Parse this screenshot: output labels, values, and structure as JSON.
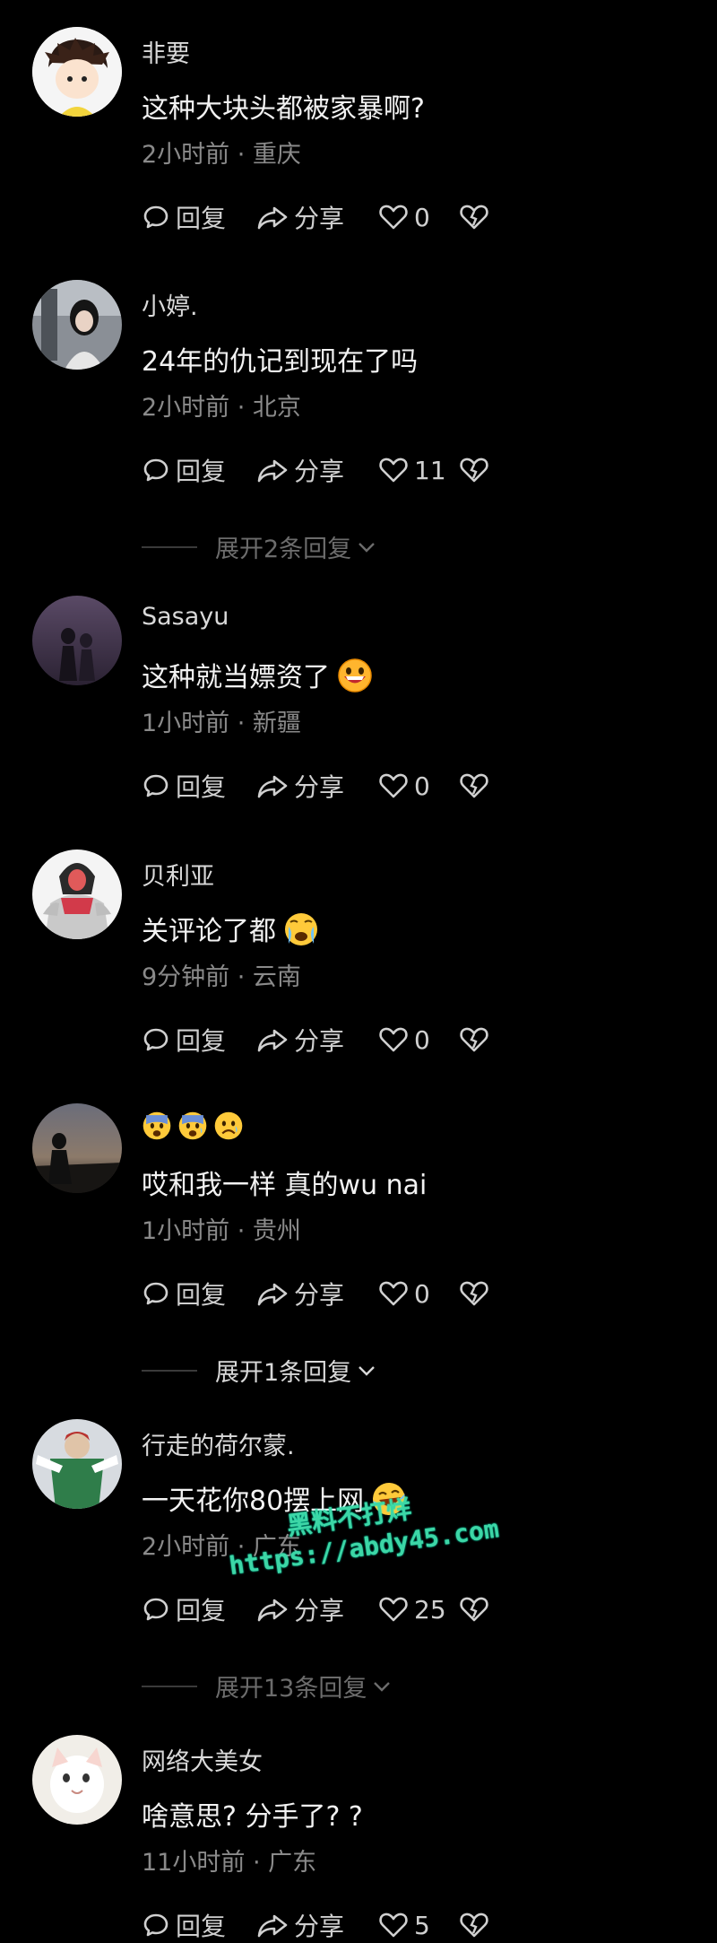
{
  "actions": {
    "reply_label": "回复",
    "share_label": "分享"
  },
  "comments": [
    {
      "username": "非要",
      "content": "这种大块头都被家暴啊?",
      "time": "2小时前",
      "location": "重庆",
      "meta": "2小时前 · 重庆",
      "likes": "0",
      "emoji": ""
    },
    {
      "username": "小婷.",
      "content": "24年的仇记到现在了吗",
      "time": "2小时前",
      "location": "北京",
      "meta": "2小时前 · 北京",
      "likes": "11",
      "emoji": ""
    },
    {
      "username": "Sasayu",
      "content": "这种就当嫖资了",
      "time": "1小时前",
      "location": "新疆",
      "meta": "1小时前 · 新疆",
      "likes": "0",
      "emoji": "grinning-face"
    },
    {
      "username": "贝利亚",
      "content": "关评论了都",
      "time": "9分钟前",
      "location": "云南",
      "meta": "9分钟前 · 云南",
      "likes": "0",
      "emoji": "crying-face"
    },
    {
      "username": "",
      "content": "哎和我一样 真的wu nai",
      "time": "1小时前",
      "location": "贵州",
      "meta": "1小时前 · 贵州",
      "likes": "0",
      "emoji": "",
      "username_emojis": [
        "anxious-face",
        "anxious-face",
        "sad-face"
      ]
    },
    {
      "username": "行走的荷尔蒙.",
      "content": "一天花你80摆上网",
      "time": "2小时前",
      "location": "广东",
      "meta": "2小时前 · 广东",
      "likes": "25",
      "emoji": "laughing-face"
    },
    {
      "username": "网络大美女",
      "content": "啥意思? 分手了? ?",
      "time": "11小时前",
      "location": "广东",
      "meta": "11小时前 · 广东",
      "likes": "5",
      "emoji": ""
    }
  ],
  "expanders": [
    {
      "label": "展开2条回复"
    },
    {
      "label": "展开1条回复"
    },
    {
      "label": "展开13条回复"
    }
  ],
  "watermark": {
    "line1": "黑料不打烊",
    "line2": "https://abdy45.com"
  },
  "colors": {
    "background": "#000000",
    "text": "#f2f2f2",
    "meta": "#8a8a8a",
    "watermark": "#3dd6a6"
  }
}
